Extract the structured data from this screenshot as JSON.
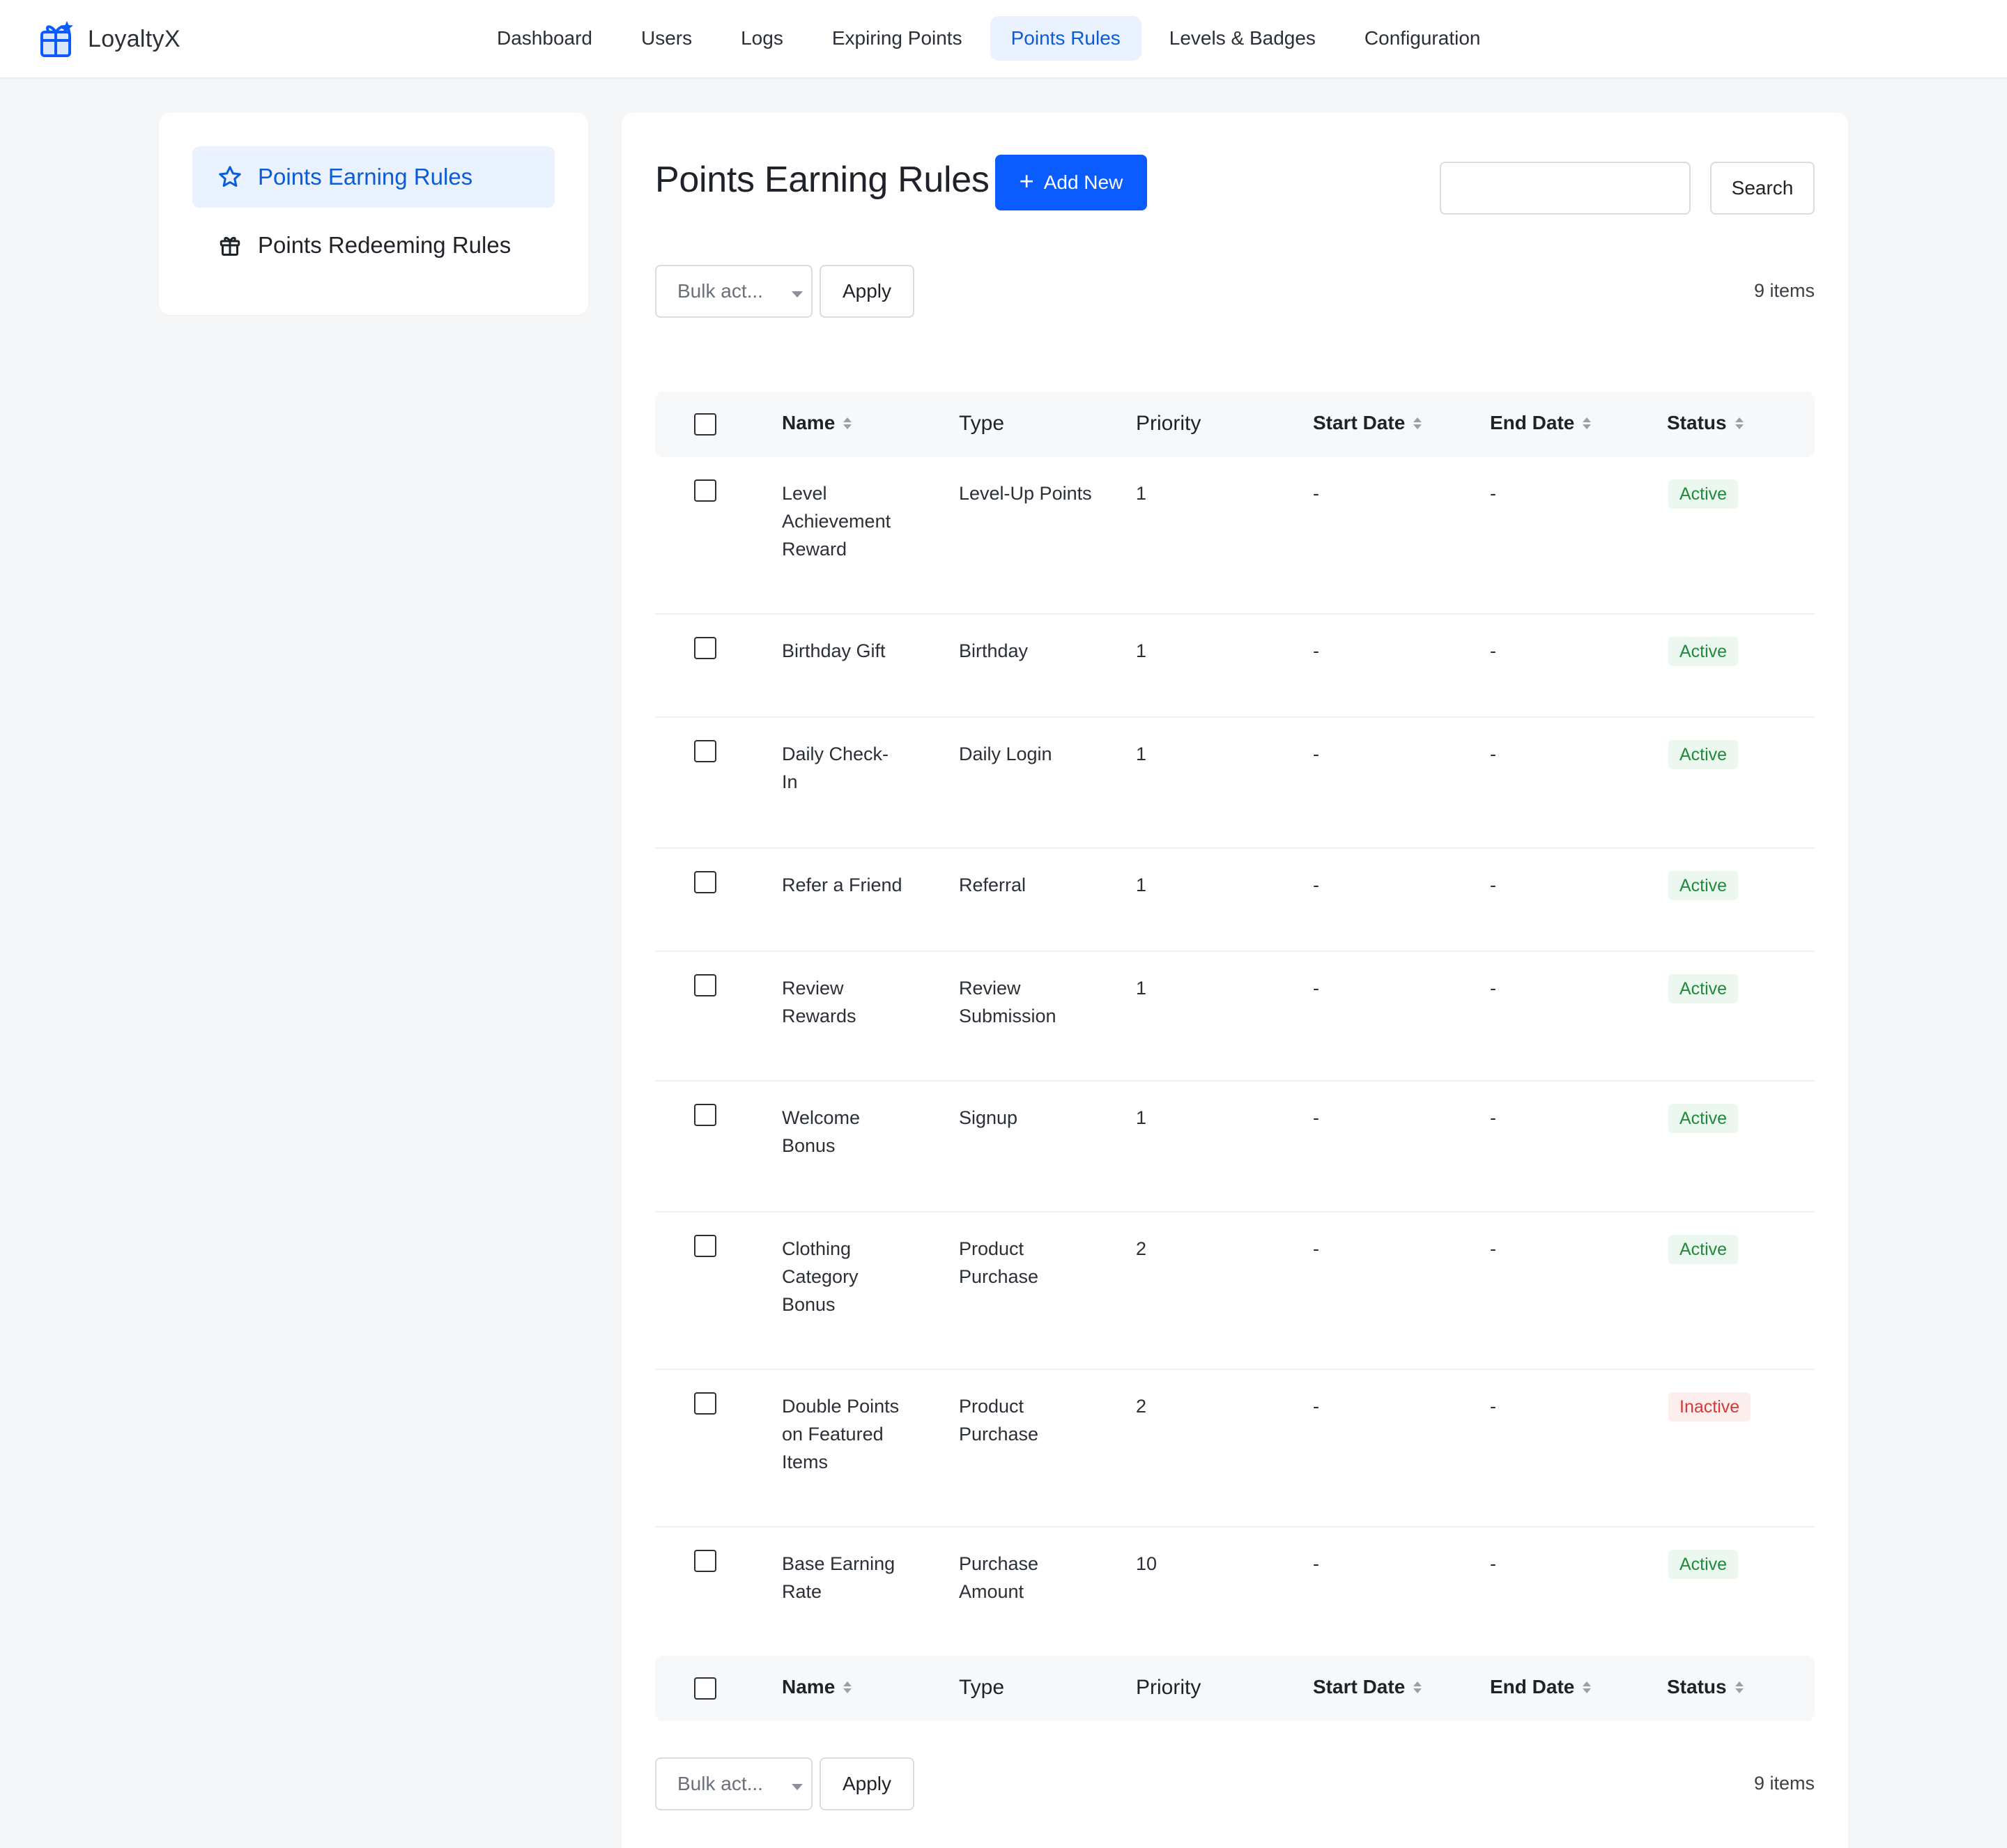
{
  "app": {
    "name": "LoyaltyX"
  },
  "nav": {
    "items": [
      {
        "label": "Dashboard",
        "active": false
      },
      {
        "label": "Users",
        "active": false
      },
      {
        "label": "Logs",
        "active": false
      },
      {
        "label": "Expiring Points",
        "active": false
      },
      {
        "label": "Points Rules",
        "active": true
      },
      {
        "label": "Levels & Badges",
        "active": false
      },
      {
        "label": "Configuration",
        "active": false
      }
    ]
  },
  "sidebar": {
    "items": [
      {
        "label": "Points Earning Rules",
        "icon": "star-icon",
        "active": true
      },
      {
        "label": "Points Redeeming Rules",
        "icon": "gift-icon",
        "active": false
      }
    ]
  },
  "main": {
    "title": "Points Earning Rules",
    "add_label": "Add New",
    "search": {
      "value": "",
      "placeholder": "",
      "button_label": "Search"
    },
    "bulk": {
      "selected": "Bulk act...",
      "apply_label": "Apply"
    },
    "item_count": "9 items"
  },
  "table": {
    "columns": [
      {
        "label": "Name",
        "sortable": true
      },
      {
        "label": "Type",
        "sortable": false
      },
      {
        "label": "Priority",
        "sortable": false
      },
      {
        "label": "Start Date",
        "sortable": true
      },
      {
        "label": "End Date",
        "sortable": true
      },
      {
        "label": "Status",
        "sortable": true
      }
    ],
    "rows": [
      {
        "name": "Level Achievement Reward",
        "type": "Level-Up Points",
        "priority": "1",
        "start": "-",
        "end": "-",
        "status": "Active"
      },
      {
        "name": "Birthday Gift",
        "type": "Birthday",
        "priority": "1",
        "start": "-",
        "end": "-",
        "status": "Active"
      },
      {
        "name": "Daily Check-In",
        "type": "Daily Login",
        "priority": "1",
        "start": "-",
        "end": "-",
        "status": "Active"
      },
      {
        "name": "Refer a Friend",
        "type": "Referral",
        "priority": "1",
        "start": "-",
        "end": "-",
        "status": "Active"
      },
      {
        "name": "Review Rewards",
        "type": "Review Submission",
        "priority": "1",
        "start": "-",
        "end": "-",
        "status": "Active"
      },
      {
        "name": "Welcome Bonus",
        "type": "Signup",
        "priority": "1",
        "start": "-",
        "end": "-",
        "status": "Active"
      },
      {
        "name": "Clothing Category Bonus",
        "type": "Product Purchase",
        "priority": "2",
        "start": "-",
        "end": "-",
        "status": "Active"
      },
      {
        "name": "Double Points on Featured Items",
        "type": "Product Purchase",
        "priority": "2",
        "start": "-",
        "end": "-",
        "status": "Inactive"
      },
      {
        "name": "Base Earning Rate",
        "type": "Purchase Amount",
        "priority": "10",
        "start": "-",
        "end": "-",
        "status": "Active"
      }
    ]
  },
  "colors": {
    "accent": "#0b5cff",
    "active_nav_bg": "#eaf1ff",
    "active_text": "#0b5cd8",
    "status_active": "#1f8a3a",
    "status_inactive": "#d33a3a"
  }
}
